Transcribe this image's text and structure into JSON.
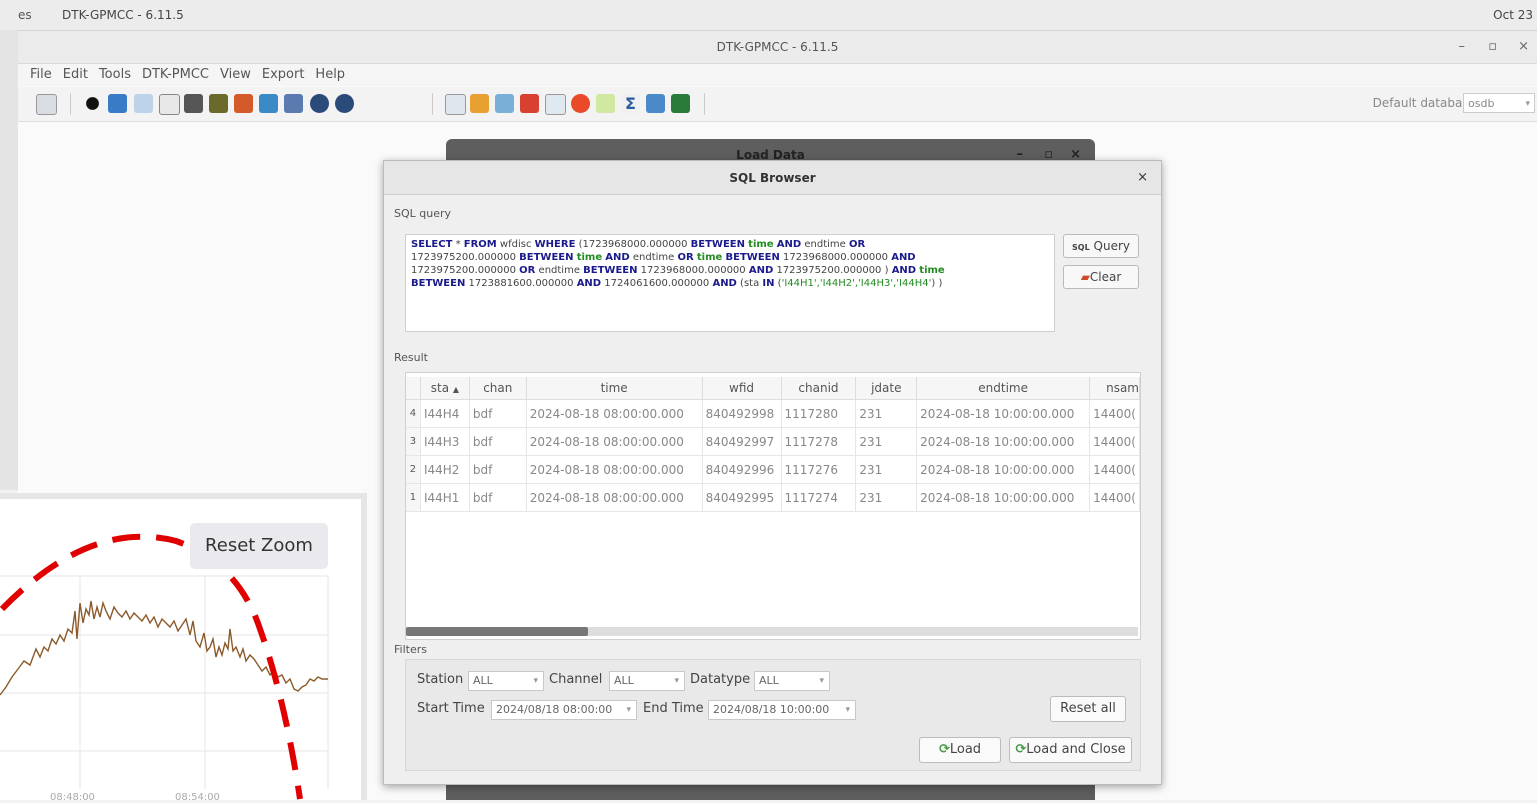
{
  "topbar": {
    "activities": "es",
    "app_name": "DTK-GPMCC - 6.11.5",
    "clock": "Oct 23"
  },
  "window": {
    "title": "DTK-GPMCC - 6.11.5",
    "minimize": "–",
    "maximize": "▫",
    "close": "×"
  },
  "menu": [
    "File",
    "Edit",
    "Tools",
    "DTK-PMCC",
    "View",
    "Export",
    "Help"
  ],
  "toolbar": {
    "db_label": "Default database:",
    "db_value": "osdb"
  },
  "loaddata": {
    "title": "Load Data",
    "minimize": "–",
    "maximize": "▫",
    "close": "×"
  },
  "sqlbrowser": {
    "title": "SQL Browser",
    "close": "×",
    "query_label": "SQL query",
    "query_btn": "Query",
    "clear_btn": "Clear",
    "result_label": "Result",
    "columns": [
      "sta",
      "chan",
      "time",
      "wfid",
      "chanid",
      "jdate",
      "endtime",
      "nsam"
    ],
    "rows": [
      {
        "n": "4",
        "sta": "I44H4",
        "chan": "bdf",
        "time": "2024-08-18 08:00:00.000",
        "wfid": "840492998",
        "chanid": "1117280",
        "jdate": "231",
        "endtime": "2024-08-18 10:00:00.000",
        "nsam": "14400("
      },
      {
        "n": "3",
        "sta": "I44H3",
        "chan": "bdf",
        "time": "2024-08-18 08:00:00.000",
        "wfid": "840492997",
        "chanid": "1117278",
        "jdate": "231",
        "endtime": "2024-08-18 10:00:00.000",
        "nsam": "14400("
      },
      {
        "n": "2",
        "sta": "I44H2",
        "chan": "bdf",
        "time": "2024-08-18 08:00:00.000",
        "wfid": "840492996",
        "chanid": "1117276",
        "jdate": "231",
        "endtime": "2024-08-18 10:00:00.000",
        "nsam": "14400("
      },
      {
        "n": "1",
        "sta": "I44H1",
        "chan": "bdf",
        "time": "2024-08-18 08:00:00.000",
        "wfid": "840492995",
        "chanid": "1117274",
        "jdate": "231",
        "endtime": "2024-08-18 10:00:00.000",
        "nsam": "14400("
      }
    ],
    "filters": {
      "label": "Filters",
      "station_label": "Station",
      "station_value": "ALL",
      "channel_label": "Channel",
      "channel_value": "ALL",
      "datatype_label": "Datatype",
      "datatype_value": "ALL",
      "start_label": "Start Time",
      "start_value": "2024/08/18 08:00:00",
      "end_label": "End Time",
      "end_value": "2024/08/18 10:00:00",
      "reset_btn": "Reset all",
      "load_btn": "Load",
      "load_close_btn": "Load and Close"
    }
  },
  "chart_overlay": {
    "reset_zoom": "Reset Zoom",
    "x_ticks": [
      "08:48:00",
      "08:54:00"
    ],
    "line_color": "#8b5a2b",
    "annotation_color": "#e00000"
  }
}
